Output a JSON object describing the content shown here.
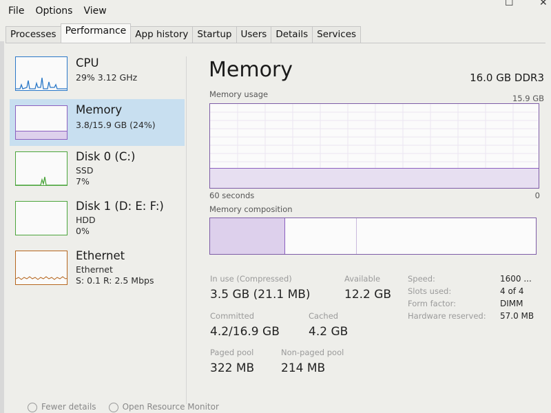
{
  "window": {
    "minimize_glyph": "─",
    "maximize_glyph": "☐",
    "close_glyph": "✕"
  },
  "menu": [
    "File",
    "Options",
    "View"
  ],
  "tabs": [
    "Processes",
    "Performance",
    "App history",
    "Startup",
    "Users",
    "Details",
    "Services"
  ],
  "active_tab": "Performance",
  "sidebar": {
    "items": [
      {
        "title": "CPU",
        "line1": "29%  3.12 GHz",
        "line2": "",
        "line3": "",
        "color": "#2a78c8"
      },
      {
        "title": "Memory",
        "line1": "3.8/15.9 GB (24%)",
        "line2": "",
        "line3": "",
        "color": "#8b5fbf"
      },
      {
        "title": "Disk 0 (C:)",
        "line1": "SSD",
        "line2": "7%",
        "line3": "",
        "color": "#4aa43a"
      },
      {
        "title": "Disk 1 (D: E: F:)",
        "line1": "HDD",
        "line2": "0%",
        "line3": "",
        "color": "#4aa43a"
      },
      {
        "title": "Ethernet",
        "line1": "Ethernet",
        "line2": "S: 0.1  R: 2.5 Mbps",
        "line3": "",
        "color": "#b5651d"
      }
    ]
  },
  "main": {
    "title": "Memory",
    "spec": "16.0 GB DDR3",
    "usage_label": "Memory usage",
    "usage_max": "15.9 GB",
    "time_left": "60 seconds",
    "time_right": "0",
    "composition_label": "Memory composition",
    "usage_fraction": 0.24
  },
  "stats": {
    "in_use_label": "In use (Compressed)",
    "in_use_value": "3.5 GB (21.1 MB)",
    "available_label": "Available",
    "available_value": "12.2 GB",
    "committed_label": "Committed",
    "committed_value": "4.2/16.9 GB",
    "cached_label": "Cached",
    "cached_value": "4.2 GB",
    "paged_label": "Paged pool",
    "paged_value": "322 MB",
    "nonpaged_label": "Non-paged pool",
    "nonpaged_value": "214 MB"
  },
  "right_stats": [
    {
      "label": "Speed:",
      "value": "1600 ..."
    },
    {
      "label": "Slots used:",
      "value": "4 of 4"
    },
    {
      "label": "Form factor:",
      "value": "DIMM"
    },
    {
      "label": "Hardware reserved:",
      "value": "57.0 MB"
    }
  ],
  "footer": {
    "fewer_details": "Fewer details",
    "open_resource_monitor": "Open Resource Monitor"
  }
}
